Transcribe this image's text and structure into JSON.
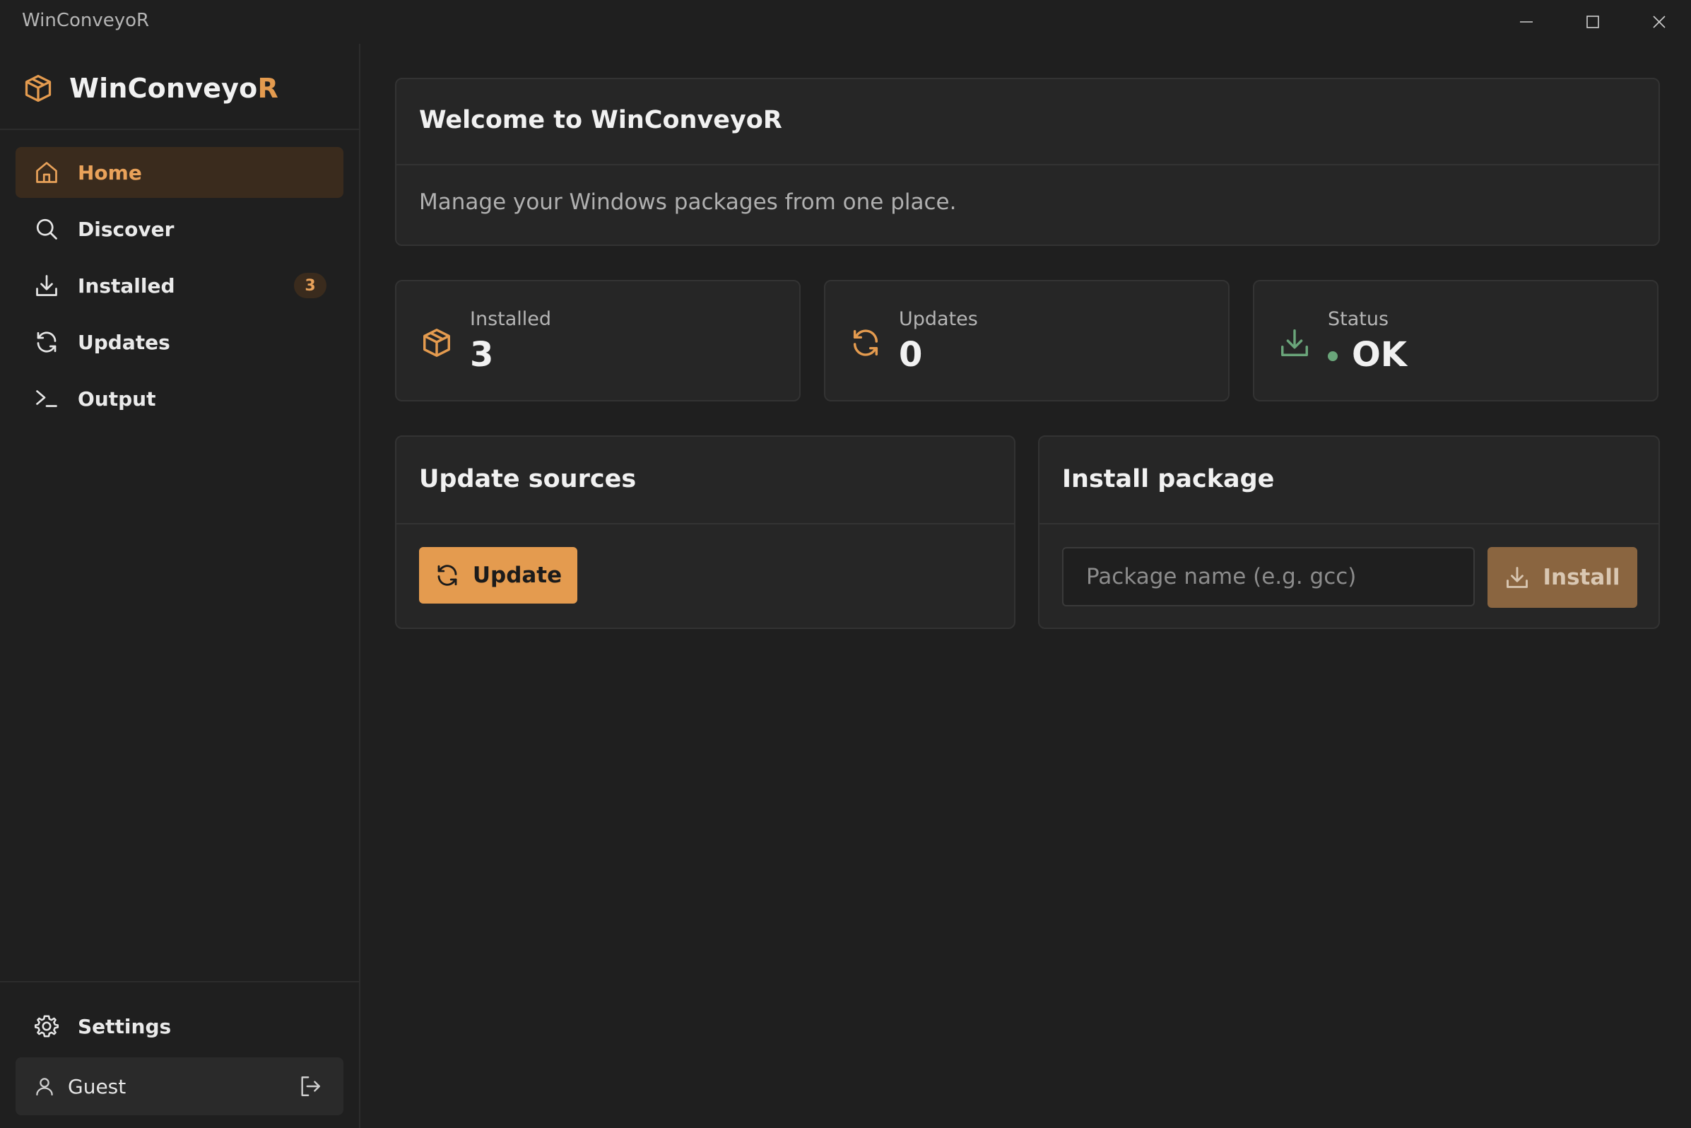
{
  "window": {
    "title": "WinConveyoR",
    "controls": [
      "minimize-icon",
      "maximize-icon",
      "close-icon"
    ]
  },
  "sidebar": {
    "brand": {
      "name_prefix": "WinConveyo",
      "name_accent": "R",
      "icon": "package-icon"
    },
    "items": [
      {
        "label": "Home",
        "icon": "home-icon",
        "active": true
      },
      {
        "label": "Discover",
        "icon": "search-icon"
      },
      {
        "label": "Installed",
        "icon": "download-icon",
        "badge": "3"
      },
      {
        "label": "Updates",
        "icon": "refresh-icon"
      },
      {
        "label": "Output",
        "icon": "terminal-icon"
      }
    ],
    "settings_label": "Settings",
    "user": {
      "name": "Guest",
      "icon": "user-icon",
      "action_icon": "logout-icon"
    }
  },
  "welcome": {
    "title": "Welcome to WinConveyoR",
    "subtitle": "Manage your Windows packages from one place."
  },
  "stats": [
    {
      "label": "Installed",
      "value": "3",
      "icon": "package-icon"
    },
    {
      "label": "Updates",
      "value": "0",
      "icon": "refresh-icon"
    },
    {
      "label": "Status",
      "value": "OK",
      "icon": "download-icon",
      "status_color": "#6aa57a"
    }
  ],
  "update_sources": {
    "title": "Update sources",
    "button_label": "Update"
  },
  "install_package": {
    "title": "Install package",
    "input_value": "",
    "input_placeholder": "Package name (e.g. gcc)",
    "button_label": "Install"
  },
  "colors": {
    "accent": "#e49b4f",
    "background": "#1f1f1f",
    "card": "#262626",
    "status_ok": "#6aa57a"
  }
}
